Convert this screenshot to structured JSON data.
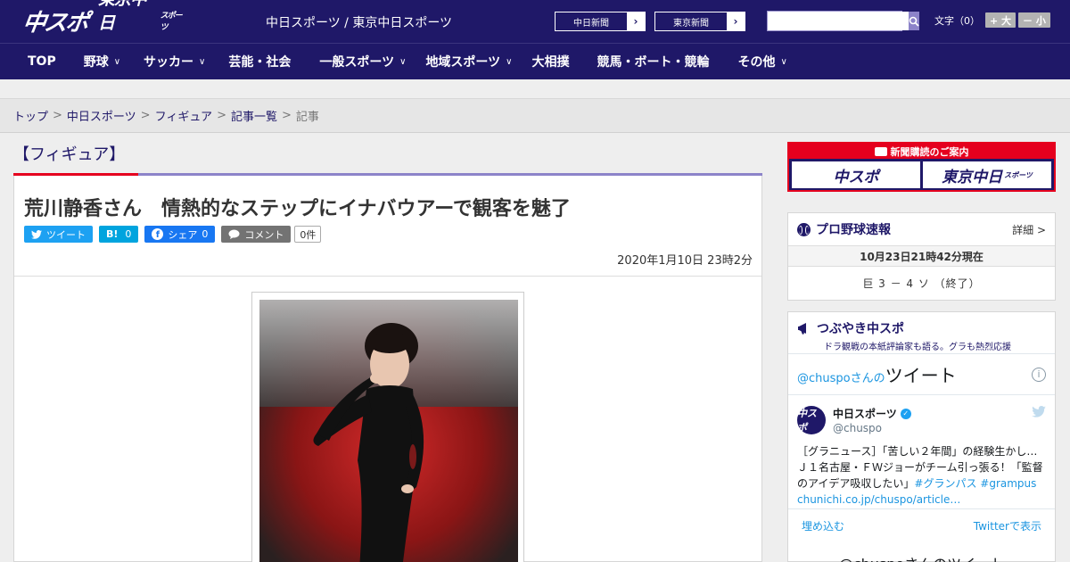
{
  "header": {
    "logo_primary": "中スポ",
    "logo_secondary": "東京中日",
    "logo_secondary_small": "スポーツ",
    "site_links": "中日スポーツ / 東京中日スポーツ",
    "paper_buttons": [
      "中日新聞",
      "東京新聞"
    ],
    "search_placeholder": "",
    "font_size_label": "文字（0）",
    "font_larger": "+ 大",
    "font_smaller": "－ 小"
  },
  "nav": {
    "items": [
      {
        "label": "TOP",
        "dropdown": false
      },
      {
        "label": "野球",
        "dropdown": true
      },
      {
        "label": "サッカー",
        "dropdown": true
      },
      {
        "label": "芸能・社会",
        "dropdown": false
      },
      {
        "label": "一般スポーツ",
        "dropdown": true
      },
      {
        "label": "地域スポーツ",
        "dropdown": true
      },
      {
        "label": "大相撲",
        "dropdown": false
      },
      {
        "label": "競馬・ボート・競輪",
        "dropdown": false
      },
      {
        "label": "その他",
        "dropdown": true
      }
    ]
  },
  "breadcrumb": {
    "items": [
      "トップ",
      "中日スポーツ",
      "フィギュア",
      "記事一覧"
    ],
    "current": "記事",
    "separator": ">"
  },
  "article": {
    "category": "【フィギュア】",
    "headline": "荒川静香さん　情熱的なステップにイナバウアーで観客を魅了",
    "share": {
      "tweet": "ツイート",
      "hatena": "B!",
      "hatena_count": "0",
      "facebook": "シェア",
      "facebook_count": "0",
      "comment": "コメント",
      "comment_count": "0件"
    },
    "date": "2020年1月10日 23時2分"
  },
  "sidebar": {
    "ad": {
      "title": "新聞購読のご案内",
      "left": "中スポ",
      "right": "東京中日",
      "right_small": "スポーツ"
    },
    "baseball": {
      "title": "プロ野球速報",
      "detail": "詳細 >",
      "time": "10月23日21時42分現在",
      "score": "巨 3 － 4 ソ （終了）"
    },
    "tsubuyaki": {
      "title": "つぶやき中スポ",
      "subtitle": "ドラ観戦の本紙評論家も語る。グラも熱烈応援",
      "embed_handle": "@chuspoさんの",
      "embed_title": "ツイート",
      "tweet": {
        "avatar": "中スポ",
        "name": "中日スポーツ",
        "handle": "@chuspo",
        "text_line1": "［グラニュース］「苦しい２年間」の経験生かし…",
        "text_line2": "Ｊ１名古屋・ＦＷジョーがチーム引っ張る！「監督",
        "text_line3_plain": "のアイデア吸収したい」",
        "text_line3_tags": "#グランパス #grampus",
        "text_link": "chunichi.co.jp/chuspo/article…"
      },
      "embed_link": "埋め込む",
      "view_on_twitter": "Twitterで表示",
      "next_heading": "@chuspoさんのツイート"
    }
  },
  "colors": {
    "brand_navy": "#1f1868",
    "accent_red": "#e5001e",
    "accent_purple": "#8c83c9",
    "twitter_blue": "#1da1f2",
    "facebook_blue": "#1877f2",
    "hatena_blue": "#00a4de"
  }
}
